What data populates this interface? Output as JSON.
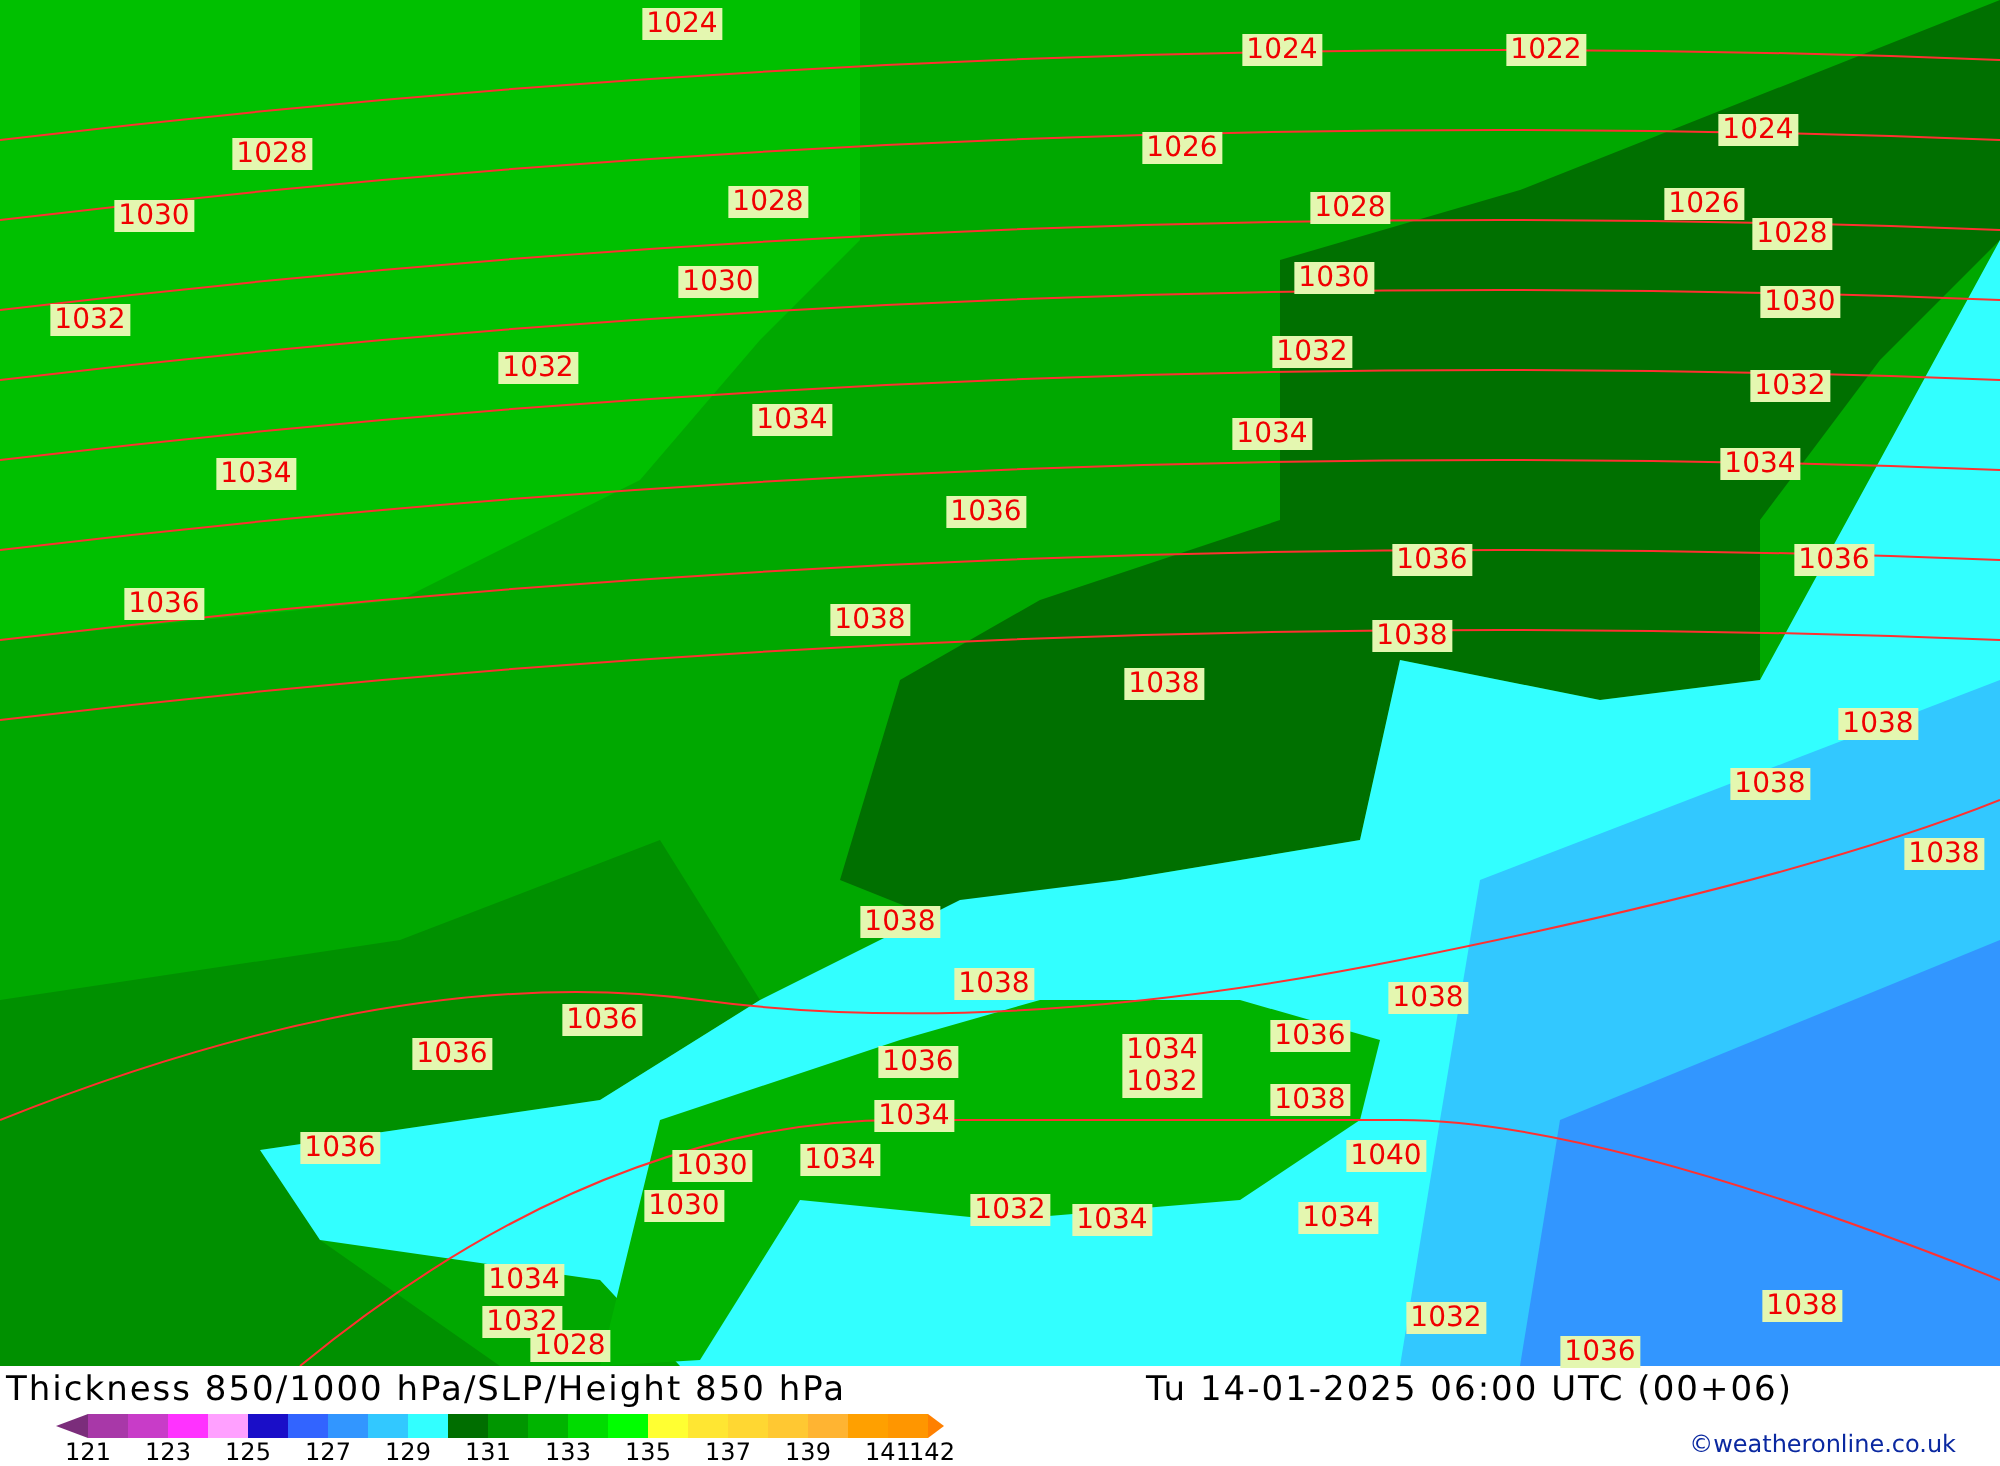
{
  "map": {
    "isobar_labels": [
      "1024",
      "1024",
      "1022",
      "1028",
      "1026",
      "1024",
      "1030",
      "1028",
      "1028",
      "1026",
      "1028",
      "1030",
      "1030",
      "1032",
      "1030",
      "1032",
      "1032",
      "1032",
      "1034",
      "1034",
      "1034",
      "1034",
      "1036",
      "1036",
      "1036",
      "1036",
      "1038",
      "1038",
      "1038",
      "1038",
      "1038",
      "1038",
      "1038",
      "1038",
      "1038",
      "1036",
      "1036",
      "1036",
      "1034",
      "1032",
      "1036",
      "1038",
      "1034",
      "1036",
      "1030",
      "1034",
      "1040",
      "1030",
      "1032",
      "1034",
      "1034",
      "1034",
      "1032",
      "1028",
      "1032",
      "1036",
      "1038"
    ]
  },
  "footer": {
    "title": "Thickness 850/1000 hPa/SLP/Height 850 hPa",
    "datetime": "Tu 14-01-2025 06:00 UTC (00+06)",
    "credit": "©weatheronline.co.uk"
  },
  "legend": {
    "swatches": [
      {
        "color": "#a838a8"
      },
      {
        "color": "#c83cc8"
      },
      {
        "color": "#ff32ff"
      },
      {
        "color": "#ffa0ff"
      },
      {
        "color": "#1a0ec8"
      },
      {
        "color": "#3264ff"
      },
      {
        "color": "#3296ff"
      },
      {
        "color": "#32c8ff"
      },
      {
        "color": "#32ffff"
      },
      {
        "color": "#006e00"
      },
      {
        "color": "#009600"
      },
      {
        "color": "#00b400"
      },
      {
        "color": "#00dc00"
      },
      {
        "color": "#00ff00"
      },
      {
        "color": "#ffff32"
      },
      {
        "color": "#ffe632"
      },
      {
        "color": "#ffd732"
      },
      {
        "color": "#ffc832"
      },
      {
        "color": "#ffb432"
      },
      {
        "color": "#ffa000"
      },
      {
        "color": "#ff9600"
      }
    ],
    "ticks": [
      "121",
      "123",
      "125",
      "127",
      "129",
      "131",
      "133",
      "135",
      "137",
      "139",
      "141",
      "142"
    ]
  }
}
